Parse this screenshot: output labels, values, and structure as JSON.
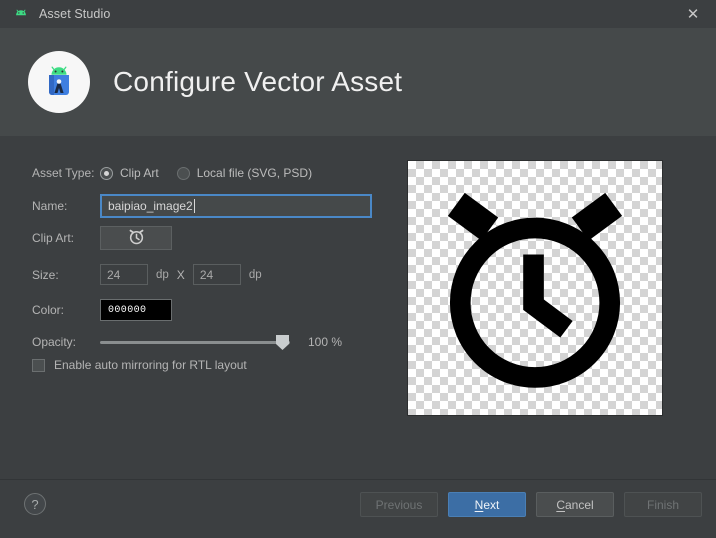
{
  "window": {
    "app_icon": "android-robot-icon",
    "title": "Asset Studio",
    "close_label": "✕"
  },
  "header": {
    "logo": "android-studio-logo",
    "title": "Configure Vector Asset"
  },
  "form": {
    "asset_type": {
      "label": "Asset Type:",
      "options": [
        {
          "label": "Clip Art",
          "selected": true
        },
        {
          "label": "Local file (SVG, PSD)",
          "selected": false
        }
      ]
    },
    "name": {
      "label": "Name:",
      "value": "baipiao_image2",
      "placeholder": ""
    },
    "clip_art": {
      "label": "Clip Art:",
      "icon": "alarm-clock-icon"
    },
    "size": {
      "label": "Size:",
      "width": "24",
      "height": "24",
      "unit": "dp",
      "separator": "X"
    },
    "color": {
      "label": "Color:",
      "value": "000000"
    },
    "opacity": {
      "label": "Opacity:",
      "value": "100 %",
      "percent": 100
    },
    "mirroring": {
      "label": "Enable auto mirroring for RTL layout",
      "checked": false
    }
  },
  "preview": {
    "icon": "alarm-clock-preview"
  },
  "footer": {
    "help_label": "?",
    "buttons": [
      {
        "label": "Previous",
        "state": "disabled"
      },
      {
        "label": "Next",
        "state": "primary",
        "mnemonic": "N"
      },
      {
        "label": "Cancel",
        "state": "normal",
        "mnemonic": "C"
      },
      {
        "label": "Finish",
        "state": "disabled"
      }
    ]
  },
  "colors": {
    "accent": "#3c6ea5",
    "focus_border": "#4a88c7",
    "window_bg": "#3c3f41",
    "header_bg": "#45494a",
    "swatch": "#000000"
  }
}
